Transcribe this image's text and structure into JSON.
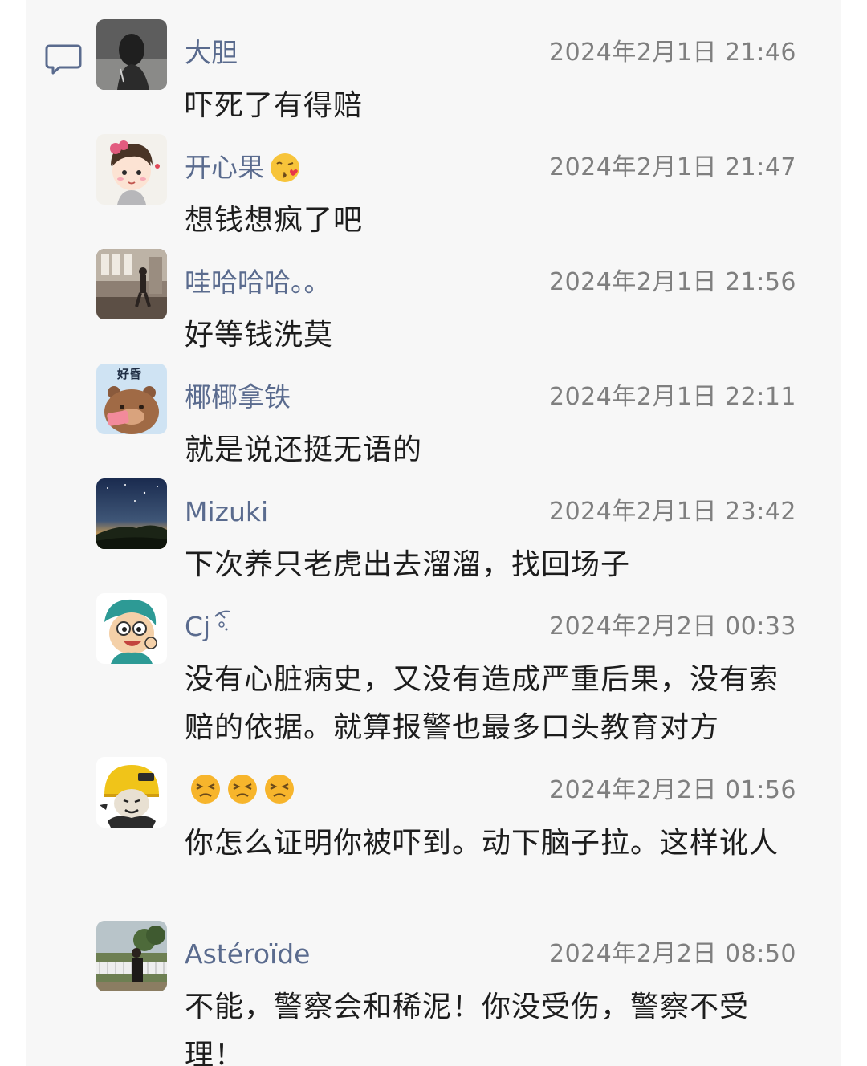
{
  "colors": {
    "panel_bg": "#f7f7f7",
    "name": "#5a6b8e",
    "time": "#7f7f7f",
    "text": "#1d1d1d"
  },
  "comments": [
    {
      "user": "大胆",
      "time": "2024年2月1日 21:46",
      "text": "吓死了有得赔",
      "avatar_icon": "dark-photo-avatar"
    },
    {
      "user": "开心果",
      "name_emoji": "kissing-face-emoji",
      "time": "2024年2月1日 21:47",
      "text": "想钱想疯了吧",
      "avatar_icon": "cartoon-girl-avatar"
    },
    {
      "user": "哇哈哈哈。。",
      "time": "2024年2月1日 21:56",
      "text": "好等钱洗莫",
      "avatar_icon": "room-photo-avatar"
    },
    {
      "user": "椰椰拿铁",
      "time": "2024年2月1日 22:11",
      "text": "就是说还挺无语的",
      "avatar_icon": "cartoon-bear-avatar",
      "avatar_text": "好昏"
    },
    {
      "user": "Mizuki",
      "time": "2024年2月1日 23:42",
      "text": "下次养只老虎出去溜溜，找回场子",
      "avatar_icon": "night-sky-avatar"
    },
    {
      "user": "Cj",
      "time": "2024年2月2日 00:33",
      "text": "没有心脏病史，又没有造成严重后果，没有索赔的依据。就算报警也最多口头教育对方",
      "avatar_icon": "cartoon-boy-avatar"
    },
    {
      "user": "",
      "name_emojis": [
        "persevering-face-emoji",
        "persevering-face-emoji",
        "persevering-face-emoji"
      ],
      "time": "2024年2月2日 01:56",
      "text": "你怎么证明你被吓到。动下脑子拉。这样讹人",
      "avatar_icon": "helmet-meme-avatar"
    },
    {
      "user": "Astéroïde",
      "time": "2024年2月2日 08:50",
      "text": "不能，警察会和稀泥！你没受伤，警察不受理！",
      "avatar_icon": "outdoor-photo-avatar"
    }
  ]
}
